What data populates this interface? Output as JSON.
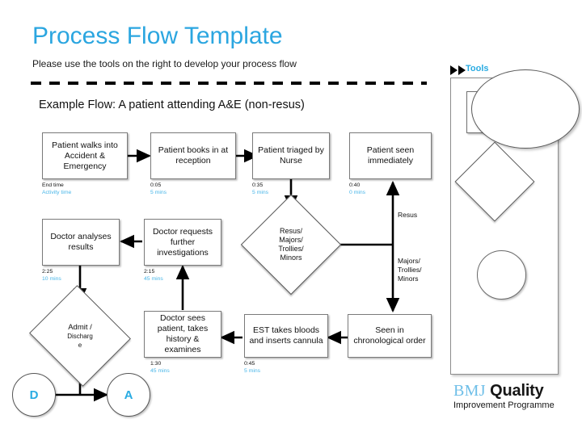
{
  "header": {
    "title": "Process Flow Template",
    "subtitle": "Please use the tools on the right to develop your process flow",
    "example_title": "Example Flow: A patient attending A&E (non-resus)"
  },
  "colors": {
    "title_blue": "#2BA6E0",
    "accent_blue": "#29ABE2",
    "activity_time_blue": "#49B6E8",
    "shape_outline": "#6f6f6f",
    "logo_blue": "#6FBFE8"
  },
  "flow": {
    "boxes": [
      {
        "id": "patient-walks-in",
        "text": "Patient walks into Accident & Emergency",
        "end_time": "End time",
        "activity_time": "Activity time"
      },
      {
        "id": "books-in",
        "text": "Patient books in at reception",
        "end_time": "0:05",
        "activity_time": "5 mins"
      },
      {
        "id": "triaged",
        "text": "Patient triaged by Nurse",
        "end_time": "0:35",
        "activity_time": "5 mins"
      },
      {
        "id": "seen-immediately",
        "text": "Patient seen immediately",
        "end_time": "0:40",
        "activity_time": "0 mins"
      },
      {
        "id": "doctor-analyses",
        "text": "Doctor analyses results",
        "end_time": "2:25",
        "activity_time": "10 mins"
      },
      {
        "id": "doctor-requests",
        "text": "Doctor requests further investigations",
        "end_time": "2:15",
        "activity_time": "45 mins"
      },
      {
        "id": "doctor-sees-patient",
        "text": "Doctor sees patient, takes history & examines",
        "end_time": "1:30",
        "activity_time": "45 mins"
      },
      {
        "id": "est-bloods",
        "text": "EST takes bloods and inserts cannula",
        "end_time": "0:45",
        "activity_time": "5 mins"
      },
      {
        "id": "chronological",
        "text": "Seen in chronological order",
        "end_time": "",
        "activity_time": ""
      }
    ],
    "decisions": [
      {
        "id": "resus-majors",
        "lines": [
          "Resus/",
          "Majors/",
          "Trollies/",
          "Minors"
        ]
      },
      {
        "id": "admit-discharge",
        "line1": "Admit /",
        "line2": "Discharg",
        "line3": "e"
      }
    ],
    "terminators": [
      {
        "id": "discharge-node",
        "label": "D"
      },
      {
        "id": "admit-node",
        "label": "A"
      }
    ],
    "edge_labels": {
      "resus": "Resus",
      "majors": [
        "Majors/",
        "Trollies/",
        "Minors"
      ]
    }
  },
  "tools": {
    "label": "Tools",
    "shapes": [
      {
        "name": "rectangle-shape-tool"
      },
      {
        "name": "ellipse-shape-tool"
      },
      {
        "name": "diamond-shape-tool"
      },
      {
        "name": "circle-shape-tool"
      },
      {
        "name": "plain-line-tool"
      },
      {
        "name": "right-arrow-tool"
      },
      {
        "name": "left-arrow-tool"
      },
      {
        "name": "double-arrow-tool"
      }
    ]
  },
  "logo": {
    "bmj": "BMJ",
    "quality": "Quality",
    "tagline": "Improvement Programme"
  }
}
